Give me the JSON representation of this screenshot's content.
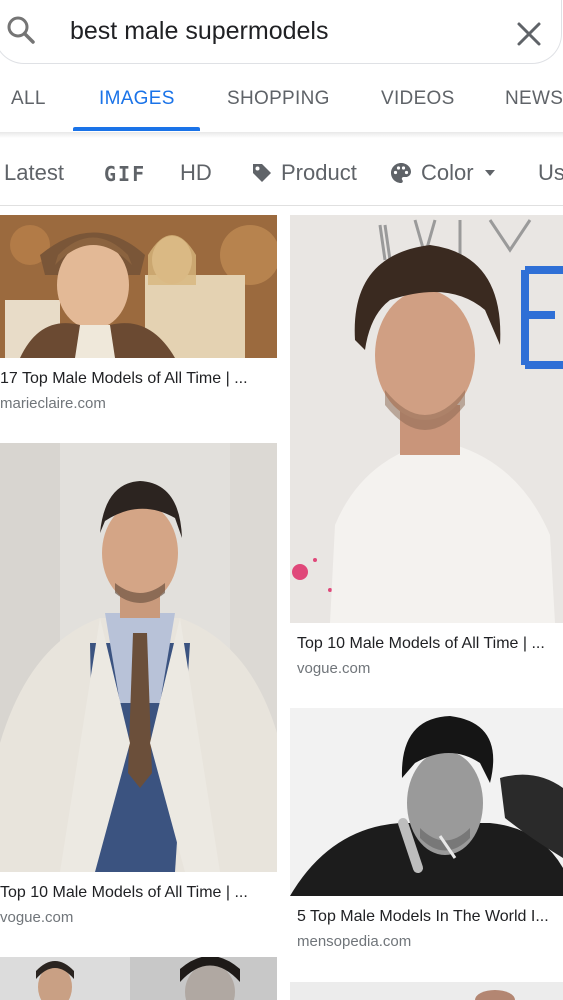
{
  "search": {
    "query": "best male supermodels"
  },
  "tabs": [
    {
      "label": "ALL"
    },
    {
      "label": "IMAGES",
      "active": true
    },
    {
      "label": "SHOPPING"
    },
    {
      "label": "VIDEOS"
    },
    {
      "label": "NEWS"
    }
  ],
  "filters": [
    {
      "label": "Latest"
    },
    {
      "label": "GIF"
    },
    {
      "label": "HD"
    },
    {
      "label": "Product",
      "icon": "tag-icon"
    },
    {
      "label": "Color",
      "icon": "palette-icon"
    },
    {
      "label": "Us"
    }
  ],
  "results": [
    {
      "title": "17 Top Male Models of All Time | ...",
      "source": "marieclaire.com"
    },
    {
      "title": "Top 10 Male Models of All Time | ...",
      "source": "vogue.com"
    },
    {
      "title": "Top 10 Male Models of All Time | ...",
      "source": "vogue.com"
    },
    {
      "title": "5 Top Male Models In The World I...",
      "source": "mensopedia.com"
    }
  ],
  "colors": {
    "accent": "#1a73e8",
    "text_secondary": "#5f6368",
    "source_text": "#70757a"
  }
}
